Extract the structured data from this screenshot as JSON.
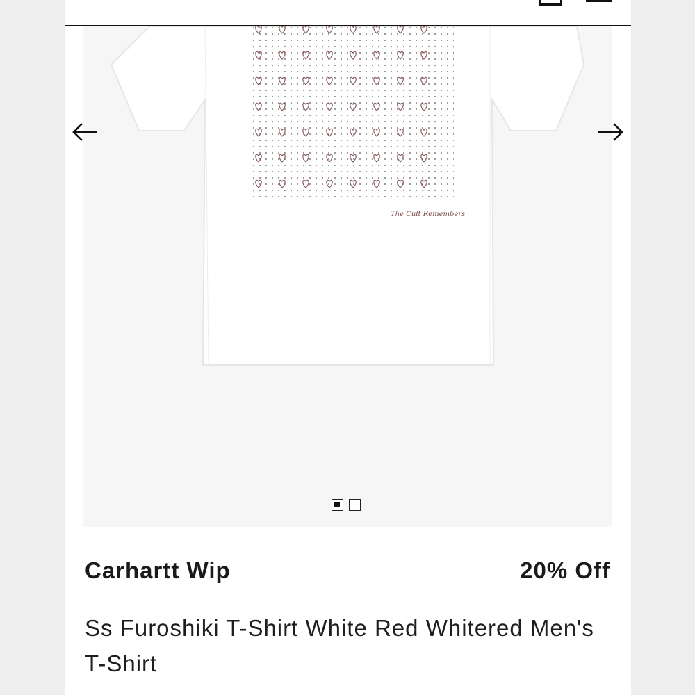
{
  "product": {
    "brand": "Carhartt Wip",
    "discount": "20% Off",
    "title": "Ss Furoshiki T-Shirt White Red Whitered Men's T-Shirt",
    "print_signature": "The Cult Remembers"
  },
  "gallery": {
    "slide_count": 2,
    "active_slide": 1
  },
  "colors": {
    "page_bg": "#ffffff",
    "side_bg": "#eeeeee",
    "gallery_bg": "#f6f6f6",
    "text": "#1a1a1a",
    "print_accent": "#8a5b5b"
  },
  "icons": {
    "prev": "arrow-left-icon",
    "next": "arrow-right-icon",
    "bag": "shopping-bag-icon",
    "menu": "hamburger-menu-icon"
  }
}
